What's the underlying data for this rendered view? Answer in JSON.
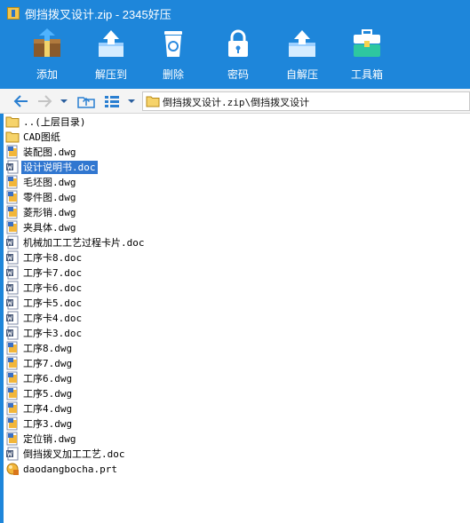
{
  "window": {
    "title": "倒挡拨叉设计.zip - 2345好压"
  },
  "toolbar": {
    "add": "添加",
    "extract": "解压到",
    "delete": "删除",
    "password": "密码",
    "sfx": "自解压",
    "toolbox": "工具箱"
  },
  "path": {
    "text": "倒挡拨叉设计.zip\\倒挡拨叉设计"
  },
  "files": [
    {
      "name": "..(上层目录)",
      "type": "parent"
    },
    {
      "name": "CAD图纸",
      "type": "folder"
    },
    {
      "name": "装配图.dwg",
      "type": "dwg"
    },
    {
      "name": "设计说明书.doc",
      "type": "doc",
      "selected": true
    },
    {
      "name": "毛坯图.dwg",
      "type": "dwg"
    },
    {
      "name": "零件图.dwg",
      "type": "dwg"
    },
    {
      "name": "菱形销.dwg",
      "type": "dwg"
    },
    {
      "name": "夹具体.dwg",
      "type": "dwg"
    },
    {
      "name": "机械加工工艺过程卡片.doc",
      "type": "doc"
    },
    {
      "name": "工序卡8.doc",
      "type": "doc"
    },
    {
      "name": "工序卡7.doc",
      "type": "doc"
    },
    {
      "name": "工序卡6.doc",
      "type": "doc"
    },
    {
      "name": "工序卡5.doc",
      "type": "doc"
    },
    {
      "name": "工序卡4.doc",
      "type": "doc"
    },
    {
      "name": "工序卡3.doc",
      "type": "doc"
    },
    {
      "name": "工序8.dwg",
      "type": "dwg"
    },
    {
      "name": "工序7.dwg",
      "type": "dwg"
    },
    {
      "name": "工序6.dwg",
      "type": "dwg"
    },
    {
      "name": "工序5.dwg",
      "type": "dwg"
    },
    {
      "name": "工序4.dwg",
      "type": "dwg"
    },
    {
      "name": "工序3.dwg",
      "type": "dwg"
    },
    {
      "name": "定位销.dwg",
      "type": "dwg"
    },
    {
      "name": "倒挡拨叉加工工艺.doc",
      "type": "doc"
    },
    {
      "name": "daodangbocha.prt",
      "type": "prt"
    }
  ]
}
